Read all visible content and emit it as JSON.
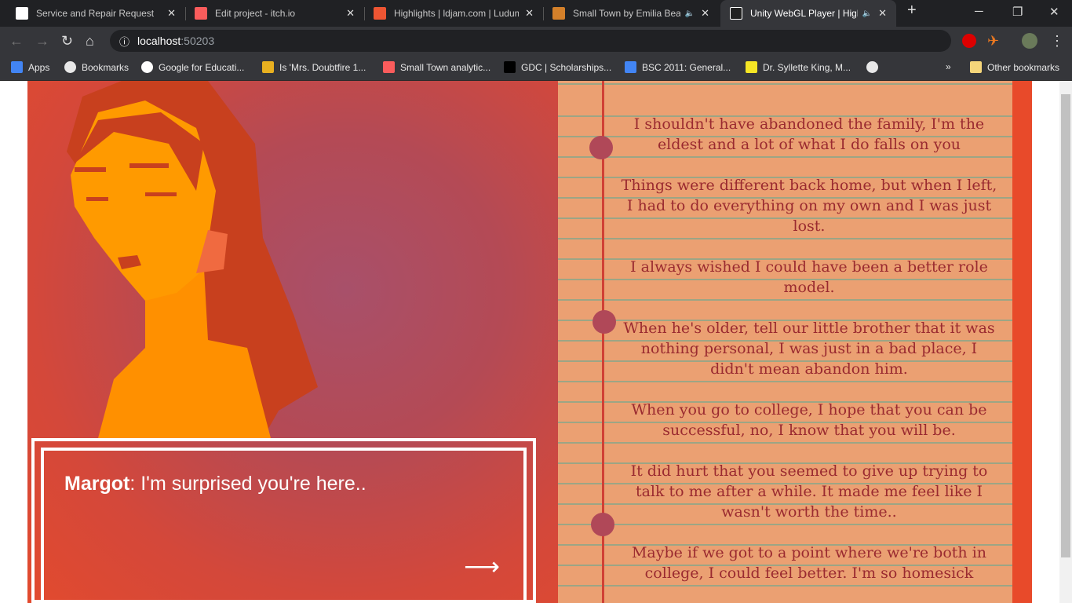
{
  "browser": {
    "tabs": [
      {
        "title": "Service and Repair Request",
        "icon": "b-logo-icon",
        "color": "#ffffff",
        "audio": false,
        "active": false
      },
      {
        "title": "Edit project - itch.io",
        "icon": "itchio-icon",
        "color": "#fa5c5c",
        "audio": false,
        "active": false
      },
      {
        "title": "Highlights | ldjam.com | Ludum Dare",
        "icon": "ldjam-icon",
        "color": "#ee5533",
        "audio": false,
        "active": false
      },
      {
        "title": "Small Town by Emilia Bea",
        "icon": "game-thumb-icon",
        "color": "#d4802a",
        "audio": true,
        "active": false
      },
      {
        "title": "Unity WebGL Player | High",
        "icon": "unity-icon",
        "color": "#222222",
        "audio": true,
        "active": true
      }
    ],
    "url_host": "localhost",
    "url_port": ":50203",
    "bookmarks": [
      {
        "label": "Apps",
        "icon": "apps-grid-icon",
        "color": "#4285f4"
      },
      {
        "label": "Bookmarks",
        "icon": "star-icon",
        "color": "#e8e8e8"
      },
      {
        "label": "Google for Educati...",
        "icon": "google-icon",
        "color": "#ffffff"
      },
      {
        "label": "Is 'Mrs. Doubtfire 1...",
        "icon": "diamond-icon",
        "color": "#e8b020"
      },
      {
        "label": "Small Town analytic...",
        "icon": "itchio-icon",
        "color": "#fa5c5c"
      },
      {
        "label": "GDC | Scholarships...",
        "icon": "gdc-icon",
        "color": "#000000"
      },
      {
        "label": "BSC 2011: General...",
        "icon": "docs-icon",
        "color": "#4285f4"
      },
      {
        "label": "Dr. Syllette King, M...",
        "icon": "z-icon",
        "color": "#f5e625"
      },
      {
        "label": "",
        "icon": "globe-icon",
        "color": "#e8e8e8"
      }
    ],
    "overflow": "»",
    "other_bookmarks": "Other bookmarks"
  },
  "game": {
    "speaker": "Margot",
    "dialogue": ": I'm surprised you're here..",
    "next_arrow": "⟶",
    "letter": [
      "I shouldn't have abandoned the family, I'm the eldest and a lot of what I do falls on you",
      "Things were different back home, but when I left, I had to do everything on my own and I was just lost.",
      "I always wished I could have been a better role model.",
      "When he's older, tell our little brother that it was nothing personal, I was just in a bad place, I didn't mean abandon him.",
      "When you go to college, I hope that you can be successful, no, I know that you will be.",
      "It did hurt that you seemed to give up trying to talk to me after a while. It made me feel like I wasn't worth the time..",
      "Maybe if we got to a point where we're both in college, I could feel better. I'm so homesick"
    ]
  }
}
